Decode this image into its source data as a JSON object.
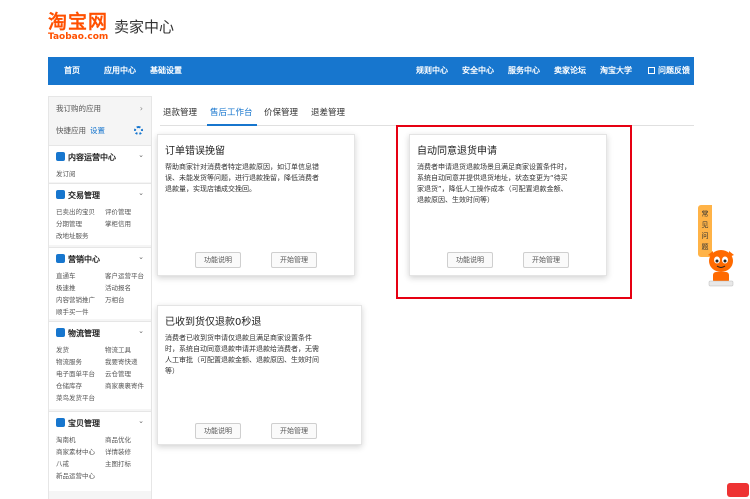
{
  "brand": {
    "logo_main": "淘宝网",
    "logo_sub": "Taobao.com",
    "title": "卖家中心",
    "color": "#ff5000"
  },
  "topnav": {
    "bg": "#1776ce",
    "left_items": [
      "首页",
      "应用中心",
      "基础设置"
    ],
    "right_items": [
      "规则中心",
      "安全中心",
      "服务中心",
      "卖家论坛",
      "淘宝大学"
    ],
    "feedback": "问题反馈"
  },
  "sidebar": {
    "my_apps": "我订购的应用",
    "quick_apps": "快捷应用",
    "settings": "设置",
    "sections": [
      {
        "title": "内容运营中心",
        "links": [
          "发订阅"
        ]
      },
      {
        "title": "交易管理",
        "links": [
          "已卖出的宝贝",
          "评价管理",
          "分期管理",
          "掌柜信用",
          "改地址服务"
        ]
      },
      {
        "title": "营销中心",
        "links": [
          "直通车",
          "客户运营平台",
          "极速推",
          "活动报名",
          "内容营销推广",
          "万相台",
          "顺手买一件"
        ]
      },
      {
        "title": "物流管理",
        "links": [
          "发货",
          "物流工具",
          "物流服务",
          "我要寄快递",
          "电子面单平台",
          "云仓管理",
          "仓储库存",
          "商家裹裹寄件",
          "菜鸟发货平台"
        ]
      },
      {
        "title": "宝贝管理",
        "links": [
          "淘南机",
          "商品优化",
          "商家素材中心",
          "详情装修",
          "八戒",
          "主图打标",
          "新品运营中心"
        ]
      }
    ]
  },
  "tabs": [
    "退款管理",
    "售后工作台",
    "价保管理",
    "退差管理"
  ],
  "active_tab": 1,
  "cards": [
    {
      "title": "订单错误挽留",
      "lines": [
        "帮助商家针对消费者特定退款原因，如订单信息错",
        "误、未能发货等问题，进行退款挽留，降低消费者",
        "退款量，实现店铺成交挽回。"
      ],
      "btn_info": "功能说明",
      "btn_manage": "开始管理"
    },
    {
      "title": "自动同意退货申请",
      "lines": [
        "消费者申请退货退款场景且满足商家设置条件时，",
        "系统自动同意并提供退货地址，状态变更为“待买",
        "家退货”，降低人工操作成本（可配置退款金额、",
        "退款原因、生效时间等）"
      ],
      "btn_info": "功能说明",
      "btn_manage": "开始管理"
    },
    {
      "title": "已收到货仅退款0秒退",
      "lines": [
        "消费者已收到货申请仅退款且满足商家设置条件",
        "时，系统自动同意退款申请并退款给消费者，无需",
        "人工审批（可配置退款金额、退款原因、生效时间",
        "等）"
      ],
      "btn_info": "功能说明",
      "btn_manage": "开始管理"
    }
  ],
  "help": {
    "label": "常见问题"
  },
  "accent_red": "#e60012"
}
